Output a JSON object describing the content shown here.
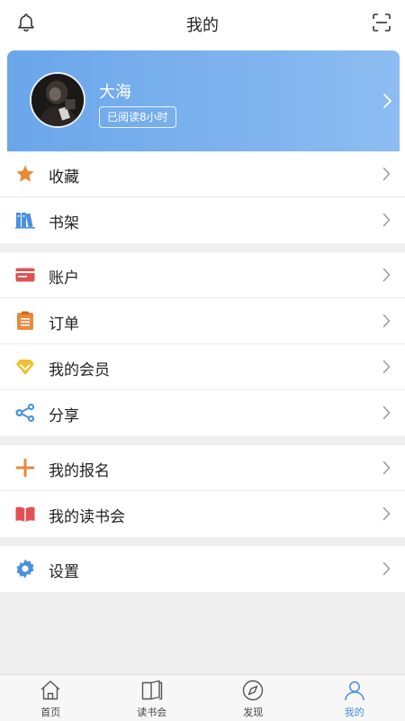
{
  "header": {
    "title": "我的",
    "left_icon": "bell-icon",
    "right_icon": "scan-icon"
  },
  "profile": {
    "name": "大海",
    "reading_badge": "已阅读8小时",
    "gradient_start": "#6aa6ea",
    "gradient_end": "#8cbcf1"
  },
  "groups": [
    {
      "items": [
        {
          "label": "收藏",
          "icon": "star-icon",
          "color": "#e88a3b"
        },
        {
          "label": "书架",
          "icon": "bookshelf-icon",
          "color": "#4a8fe0"
        }
      ]
    },
    {
      "items": [
        {
          "label": "账户",
          "icon": "card-icon",
          "color": "#e05252"
        },
        {
          "label": "订单",
          "icon": "clipboard-icon",
          "color": "#e88a3b"
        },
        {
          "label": "我的会员",
          "icon": "diamond-icon",
          "color": "#f0c030"
        },
        {
          "label": "分享",
          "icon": "share-icon",
          "color": "#4a8fe0"
        }
      ]
    },
    {
      "items": [
        {
          "label": "我的报名",
          "icon": "plus-icon",
          "color": "#e88a3b"
        },
        {
          "label": "我的读书会",
          "icon": "open-book-icon",
          "color": "#e05252"
        }
      ]
    },
    {
      "items": [
        {
          "label": "设置",
          "icon": "gear-icon",
          "color": "#4a8fe0"
        }
      ]
    }
  ],
  "tabbar": {
    "tabs": [
      {
        "label": "首页",
        "icon": "home-icon"
      },
      {
        "label": "读书会",
        "icon": "book-icon"
      },
      {
        "label": "发现",
        "icon": "compass-icon"
      },
      {
        "label": "我的",
        "icon": "person-icon"
      }
    ],
    "active_color": "#4a8fe0",
    "inactive_color": "#444444"
  }
}
